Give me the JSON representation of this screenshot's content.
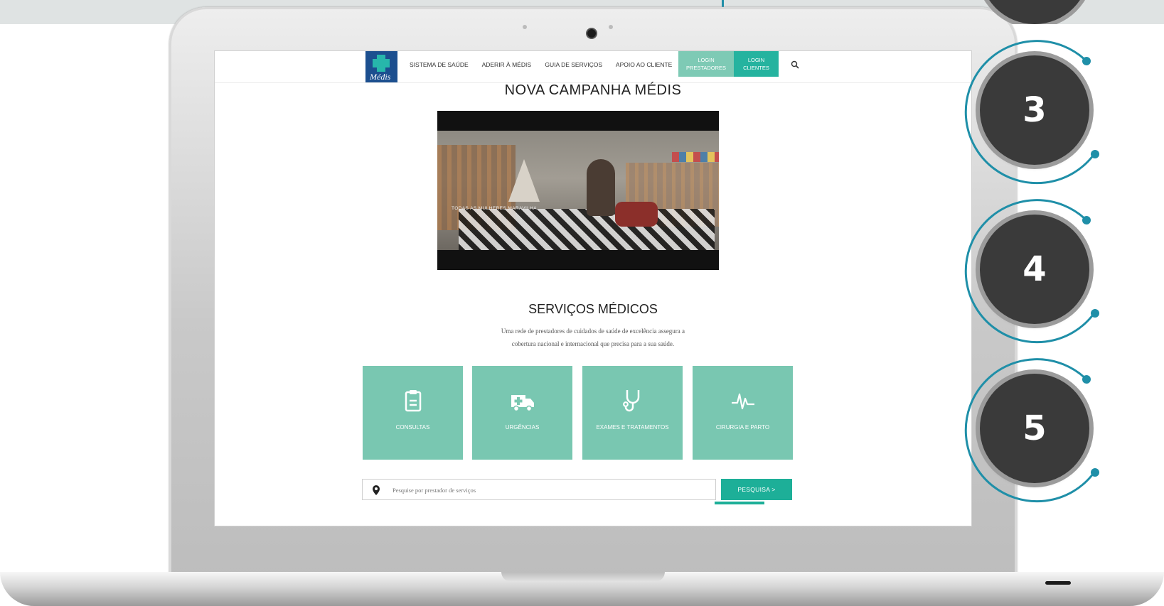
{
  "site": {
    "logo_text": "Médis",
    "nav": [
      "SISTEMA DE SAÚDE",
      "ADERIR À MÉDIS",
      "GUIA DE SERVIÇOS",
      "APOIO AO CLIENTE"
    ],
    "login_prestadores": "LOGIN\nPRESTADORES",
    "login_clientes": "LOGIN\nCLIENTES"
  },
  "campaign": {
    "title": "NOVA CAMPANHA MÉDIS",
    "video_caption": "TODAS AS MULHERES MARAVILHA"
  },
  "services": {
    "title": "SERVIÇOS MÉDICOS",
    "description_line1": "Uma rede de prestadores de cuidados de saúde de excelência assegura a",
    "description_line2": "cobertura nacional e internacional que precisa para a sua saúde.",
    "tiles": [
      {
        "label": "CONSULTAS",
        "icon": "clipboard-icon"
      },
      {
        "label": "URGÊNCIAS",
        "icon": "ambulance-icon"
      },
      {
        "label": "EXAMES E TRATAMENTOS",
        "icon": "stethoscope-icon"
      },
      {
        "label": "CIRURGIA E PARTO",
        "icon": "heartbeat-icon"
      }
    ]
  },
  "search": {
    "placeholder": "Pesquise por prestador de serviços",
    "button_label": "PESQUISA  >"
  },
  "markers": [
    "3",
    "4",
    "5"
  ],
  "colors": {
    "teal_tile": "#79c7b1",
    "teal_button": "#1daf98",
    "medis_blue": "#1c4f8f",
    "marker_ring": "#1f8fa8"
  }
}
